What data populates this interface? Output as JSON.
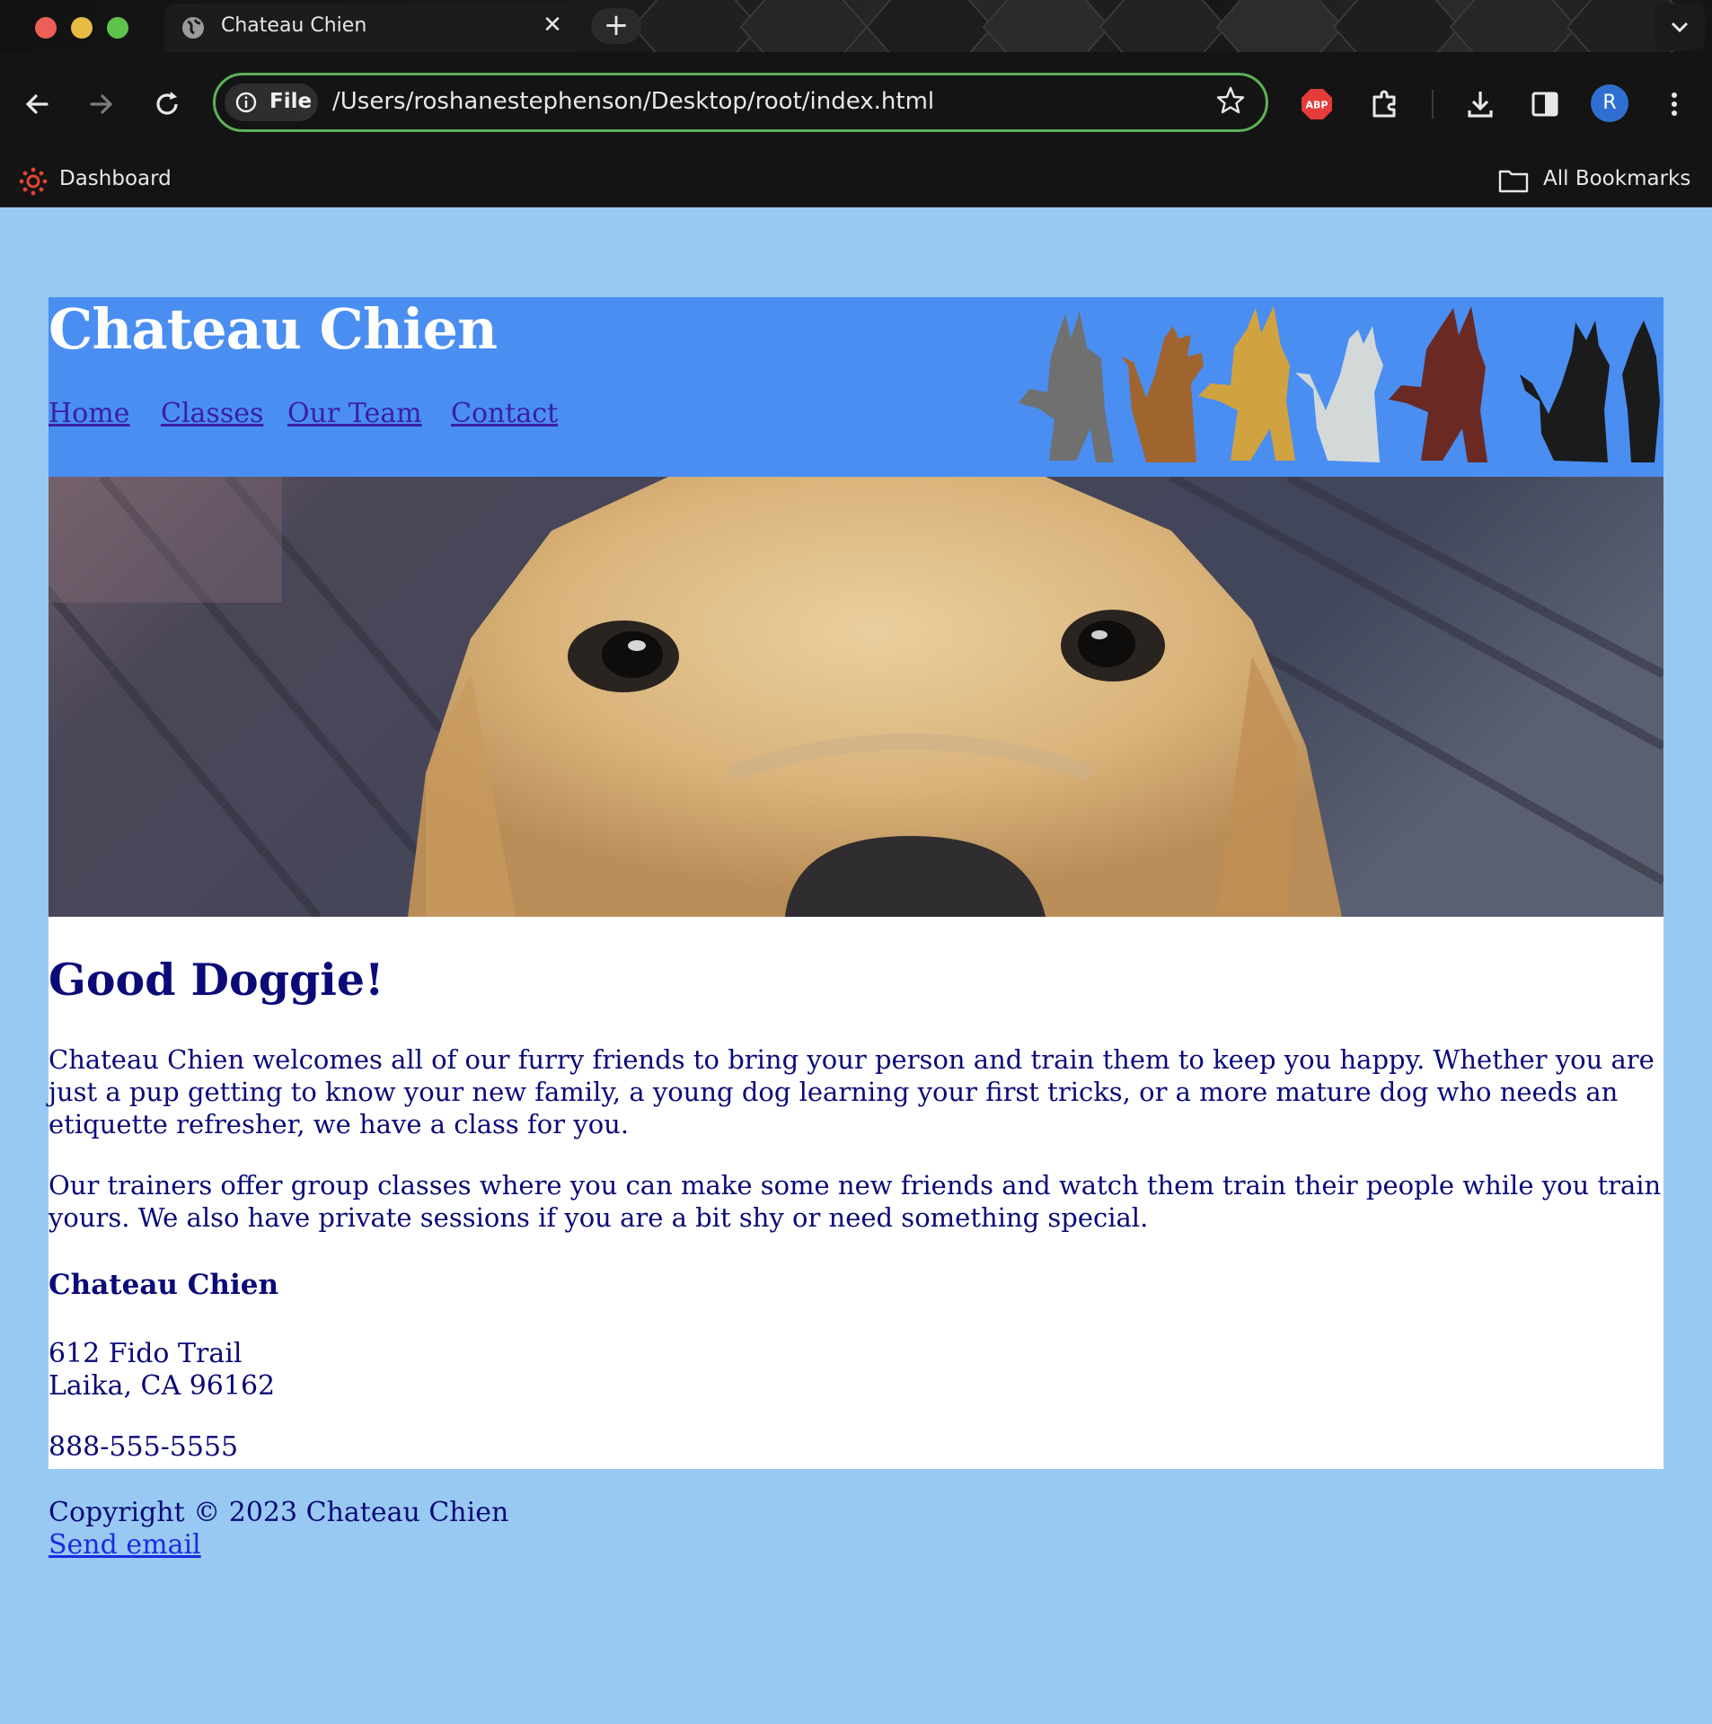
{
  "browser": {
    "tab_title": "Chateau Chien",
    "url_scheme_label": "File",
    "url": "/Users/roshanestephenson/Desktop/root/index.html",
    "extension_badge": "ABP",
    "profile_initial": "R",
    "bookmarks": {
      "left_item": "Dashboard",
      "right_item": "All Bookmarks"
    },
    "icons": [
      "back-icon",
      "forward-icon",
      "reload-icon",
      "info-icon",
      "star-icon",
      "extensions-icon",
      "download-icon",
      "side-panel-icon",
      "kebab-menu-icon"
    ]
  },
  "site": {
    "title": "Chateau Chien",
    "nav": [
      "Home",
      "Classes",
      "Our Team",
      "Contact"
    ],
    "header_color": "#4a8ef2",
    "background_color": "#98c9f2",
    "text_color": "#0a0a78"
  },
  "main": {
    "heading": "Good Doggie!",
    "paragraphs": [
      "Chateau Chien welcomes all of our furry friends to bring your person and train them to keep you happy. Whether you are just a pup getting to know your new family, a young dog learning your first tricks, or a more mature dog who needs an etiquette refresher, we have a class for you.",
      "Our trainers offer group classes where you can make some new friends and watch them train their people while you train yours. We also have private sessions if you are a bit shy or need something special."
    ],
    "address": {
      "name": "Chateau Chien",
      "street": "612 Fido Trail",
      "city": "Laika, CA 96162",
      "phone": "888-555-5555"
    }
  },
  "footer": {
    "copyright": "Copyright © 2023 Chateau Chien",
    "email_link": "Send email"
  }
}
